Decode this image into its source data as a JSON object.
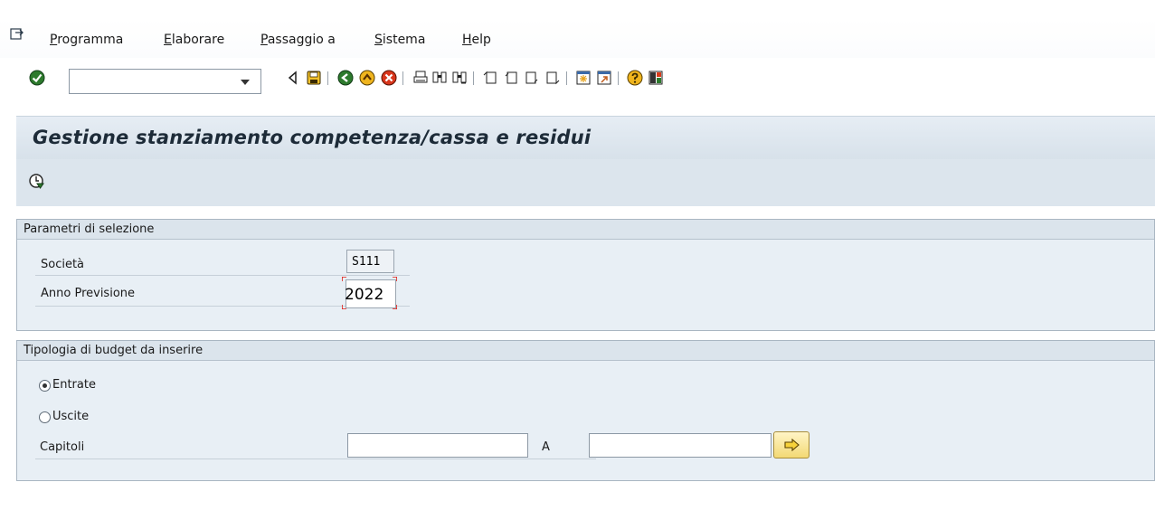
{
  "menu": {
    "items": [
      {
        "underline": "P",
        "rest": "rogramma"
      },
      {
        "underline": "E",
        "rest": "laborare"
      },
      {
        "underline": "P",
        "rest": "assaggio a"
      },
      {
        "underline": "S",
        "rest": "istema"
      },
      {
        "underline": "H",
        "rest": "elp"
      }
    ]
  },
  "toolbar": {
    "command_field_value": "",
    "icons": [
      "enter-check-icon",
      "command-dropdown-icon",
      "back-arrow-icon",
      "save-icon",
      "back-icon",
      "exit-icon",
      "cancel-icon",
      "print-icon",
      "find-icon",
      "find-next-icon",
      "first-page-icon",
      "previous-page-icon",
      "next-page-icon",
      "last-page-icon",
      "create-session-icon",
      "shortcut-icon",
      "help-icon",
      "layout-icon"
    ]
  },
  "title": {
    "text": "Gestione stanziamento competenza/cassa e residui"
  },
  "app_toolbar": {
    "icons": [
      "execute-icon"
    ]
  },
  "selection": {
    "title": "Parametri di selezione",
    "company_label": "Società",
    "company_value": "S111",
    "year_label": "Anno Previsione",
    "year_value": "2022"
  },
  "budget": {
    "title": "Tipologia di budget da inserire",
    "radio_entrate": "Entrate",
    "radio_uscite": "Uscite",
    "selected": "Entrate",
    "chapters_label": "Capitoli",
    "chapters_from": "",
    "to_label": "A",
    "chapters_to": ""
  },
  "colors": {
    "title_bar": "#d7e1ea",
    "group_bg": "#e8eff5",
    "focus_corner": "#e0201a"
  }
}
